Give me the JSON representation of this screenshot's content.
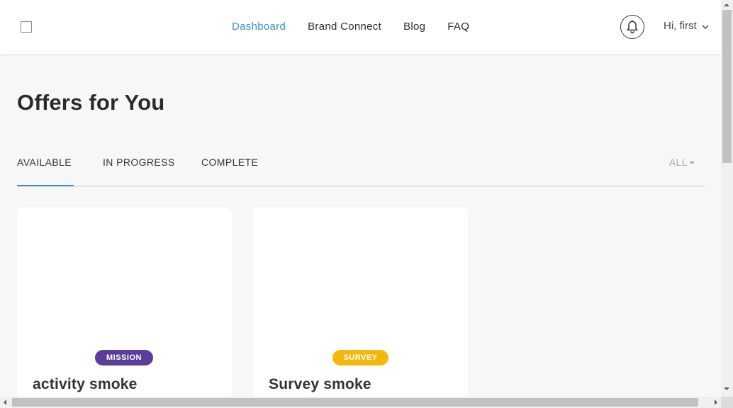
{
  "header": {
    "nav": [
      "Dashboard",
      "Brand Connect",
      "Blog",
      "FAQ"
    ],
    "active_nav": "Dashboard",
    "greeting": "Hi, first",
    "bell_icon": "bell-icon",
    "accent_color": "#3a8fd0"
  },
  "main": {
    "title": "Offers for You",
    "tabs": [
      "AVAILABLE",
      "IN PROGRESS",
      "COMPLETE"
    ],
    "active_tab": "AVAILABLE",
    "filter_label": "ALL"
  },
  "cards": [
    {
      "badge": "MISSION",
      "badge_color": "#5c3d99",
      "title": "activity smoke"
    },
    {
      "badge": "SURVEY",
      "badge_color": "#f2b90c",
      "title": "Survey smoke"
    }
  ]
}
